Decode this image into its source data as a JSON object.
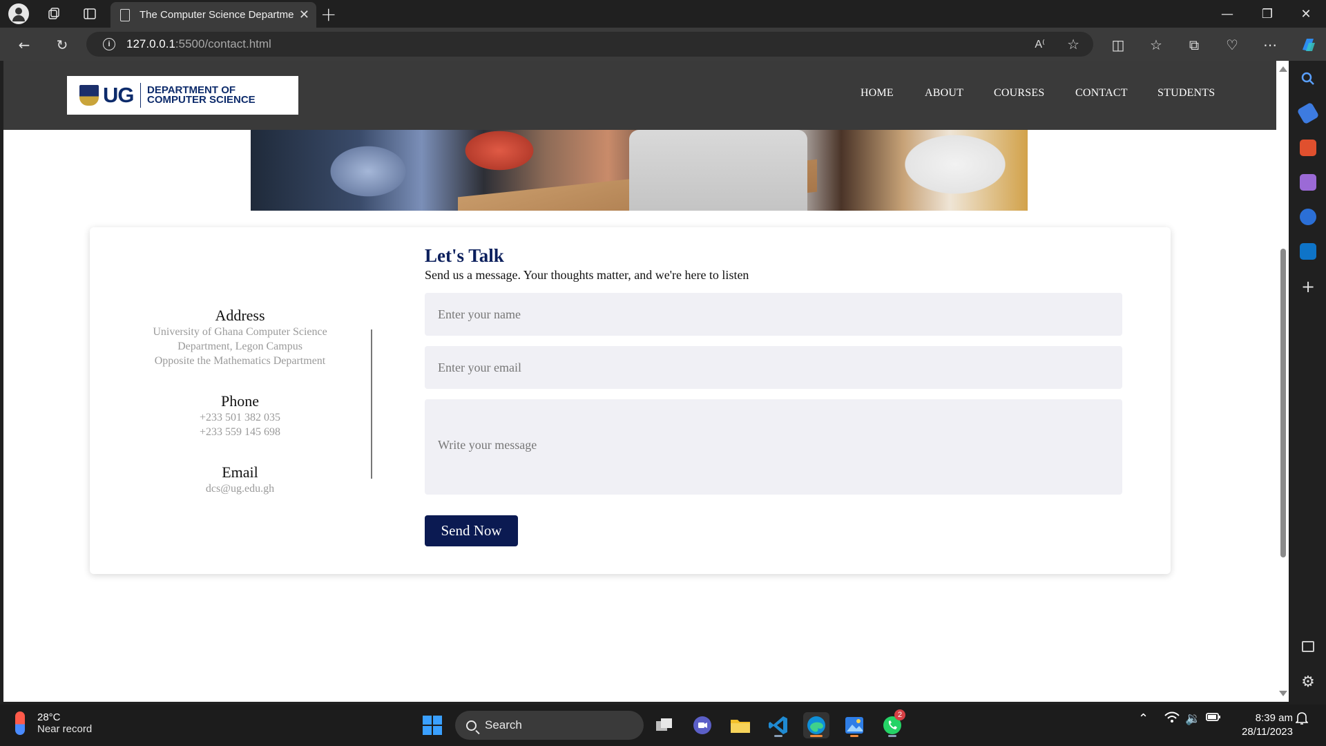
{
  "browser": {
    "tab_title": "The Computer Science Department",
    "url_host": "127.0.0.1",
    "url_path": ":5500/contact.html"
  },
  "site": {
    "logo_ug": "UG",
    "logo_dept_line1": "DEPARTMENT OF",
    "logo_dept_line2": "COMPUTER SCIENCE",
    "nav": [
      "HOME",
      "ABOUT",
      "COURSES",
      "CONTACT",
      "STUDENTS"
    ]
  },
  "contact": {
    "address_title": "Address",
    "address_lines": [
      "University of Ghana Computer Science",
      "Department, Legon Campus",
      "Opposite the Mathematics Department"
    ],
    "phone_title": "Phone",
    "phone_lines": [
      "+233 501 382 035",
      "+233 559 145 698"
    ],
    "email_title": "Email",
    "email_value": "dcs@ug.edu.gh"
  },
  "form": {
    "heading": "Let's Talk",
    "subheading": "Send us a message. Your thoughts matter, and we're here to listen",
    "name_placeholder": "Enter your name",
    "email_placeholder": "Enter your email",
    "message_placeholder": "Write your message",
    "submit_label": "Send Now"
  },
  "taskbar": {
    "temperature": "28°C",
    "weather_note": "Near record",
    "search_label": "Search",
    "whatsapp_badge": "2",
    "time": "8:39 am",
    "date": "28/11/2023"
  },
  "colors": {
    "accent_navy": "#0b1a52",
    "header_bg": "#3a3a3a"
  }
}
